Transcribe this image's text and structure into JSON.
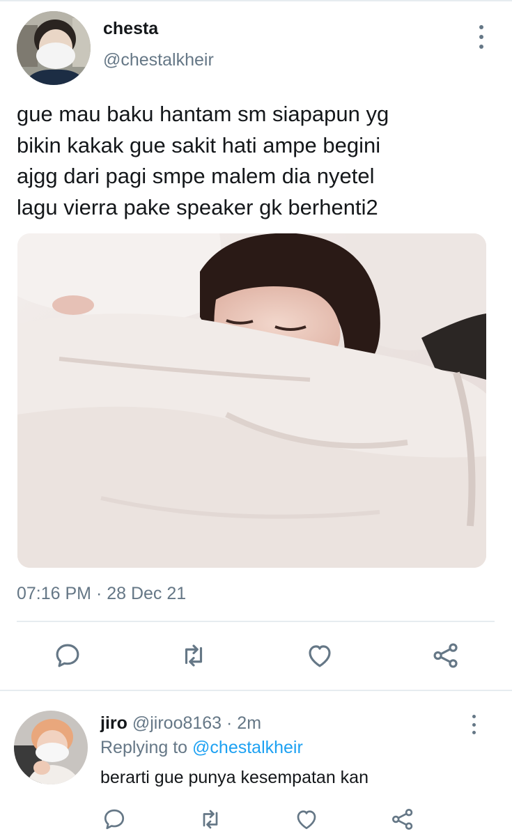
{
  "colors": {
    "text_primary": "#14171a",
    "text_secondary": "#657786",
    "link": "#1da1f2",
    "divider": "#e6ecf0"
  },
  "tweet": {
    "author_name": "chesta",
    "author_handle": "@chestalkheir",
    "text_lines": [
      "gue mau baku hantam sm siapapun yg",
      "bikin kakak gue sakit hati ampe begini",
      "ajgg dari pagi smpe malem dia nyetel",
      "lagu vierra pake speaker gk berhenti2"
    ],
    "timestamp": "07:16 PM · 28 Dec 21",
    "actions": [
      "reply-icon",
      "retweet-icon",
      "like-icon",
      "share-icon"
    ]
  },
  "reply": {
    "author_name": "jiro",
    "meta": " @jiroo8163 · 2m",
    "replying_prefix": "Replying to ",
    "replying_mention": "@chestalkheir",
    "text": "berarti gue punya kesempatan kan",
    "actions": [
      "reply-icon",
      "retweet-icon",
      "like-icon",
      "share-icon"
    ]
  }
}
